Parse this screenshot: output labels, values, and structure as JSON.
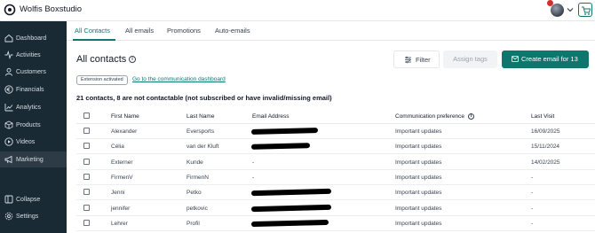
{
  "header": {
    "app_title": "Wolfis Boxstudio"
  },
  "sidebar": {
    "items": [
      {
        "label": "Dashboard",
        "icon": "home-icon"
      },
      {
        "label": "Activities",
        "icon": "activity-icon"
      },
      {
        "label": "Customers",
        "icon": "user-icon"
      },
      {
        "label": "Financials",
        "icon": "euro-icon"
      },
      {
        "label": "Analytics",
        "icon": "chart-icon"
      },
      {
        "label": "Products",
        "icon": "box-icon"
      },
      {
        "label": "Videos",
        "icon": "play-icon"
      },
      {
        "label": "Marketing",
        "icon": "megaphone-icon"
      }
    ],
    "bottom_items": [
      {
        "label": "Collapse",
        "icon": "collapse-icon"
      },
      {
        "label": "Settings",
        "icon": "gear-icon"
      }
    ]
  },
  "tabs": [
    "All Contacts",
    "All emails",
    "Promotions",
    "Auto-emails"
  ],
  "main": {
    "title": "All contacts",
    "filter_label": "Filter",
    "assign_tags_label": "Assign tags",
    "create_email_label": "Create email for 13",
    "extension_badge": "Extension activated",
    "comm_link": "Go to the communication dashboard",
    "summary": "21 contacts, 8 are not contactable (not subscribed or have invalid/missing email)"
  },
  "table": {
    "columns": [
      "First Name",
      "Last Name",
      "Email Address",
      "Communication preference",
      "Last Visit"
    ],
    "rows": [
      {
        "first": "Alexander",
        "last": "Eversports",
        "email": "",
        "pref": "Important updates",
        "visit": "16/09/2025"
      },
      {
        "first": "Célia",
        "last": "van der Kluft",
        "email": "",
        "pref": "Important updates",
        "visit": "15/11/2024"
      },
      {
        "first": "Externer",
        "last": "Kunde",
        "email": "-",
        "pref": "Important updates",
        "visit": "14/02/2025"
      },
      {
        "first": "FirmenV",
        "last": "FirmenN",
        "email": "-",
        "pref": "Important updates",
        "visit": "-"
      },
      {
        "first": "Jenni",
        "last": "Petko",
        "email": "",
        "pref": "Important updates",
        "visit": "-"
      },
      {
        "first": "jennifer",
        "last": "petkovic",
        "email": "",
        "pref": "Important updates",
        "visit": "-"
      },
      {
        "first": "Lehrer",
        "last": "Profil",
        "email": "",
        "pref": "Important updates",
        "visit": "-"
      }
    ]
  },
  "colors": {
    "accent": "#0f766e",
    "sidebar_bg": "#1a2a35",
    "badge_red": "#d32f2f"
  }
}
